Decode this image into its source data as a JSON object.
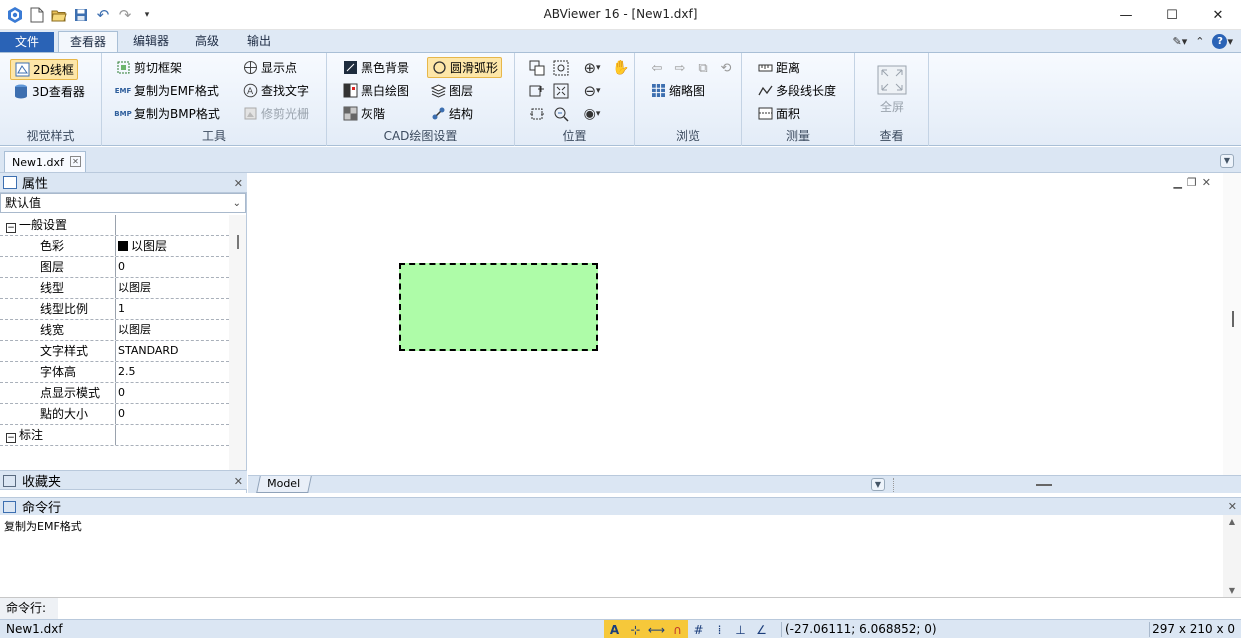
{
  "window": {
    "title": "ABViewer 16 - [New1.dxf]",
    "minimize_glyph": "—",
    "maximize_glyph": "☐",
    "close_glyph": "✕"
  },
  "ribbon_tabs": {
    "file": "文件",
    "viewer": "查看器",
    "editor": "编辑器",
    "advanced": "高级",
    "output": "输出"
  },
  "groups": {
    "visual_style": {
      "label": "视觉样式",
      "btn_2d": "2D线框",
      "btn_3d": "3D查看器"
    },
    "tools": {
      "label": "工具",
      "clip_frame": "剪切框架",
      "copy_emf": "复制为EMF格式",
      "copy_bmp": "复制为BMP格式",
      "show_points": "显示点",
      "find_text": "查找文字",
      "trim_raster": "修剪光栅"
    },
    "cad_settings": {
      "label": "CAD绘图设置",
      "black_bg": "黑色背景",
      "bw_drawing": "黑白绘图",
      "grayscale": "灰階",
      "smooth_arcs": "圆滑弧形",
      "layers": "图层",
      "structure": "结构"
    },
    "position": {
      "label": "位置"
    },
    "browse": {
      "label": "浏览",
      "thumbnail": "缩略图"
    },
    "measure": {
      "label": "测量",
      "distance": "距离",
      "polyline_length": "多段线长度",
      "area": "面积"
    },
    "view": {
      "label": "查看",
      "fullscreen": "全屏"
    }
  },
  "document": {
    "tab_name": "New1.dxf",
    "model_tab": "Model"
  },
  "properties": {
    "title": "属性",
    "select_value": "默认值",
    "categories": {
      "general": "一般设置",
      "annotation": "标注"
    },
    "rows": [
      {
        "key": "色彩",
        "value": "以图层"
      },
      {
        "key": "图层",
        "value": "0"
      },
      {
        "key": "线型",
        "value": "以图层"
      },
      {
        "key": "线型比例",
        "value": "1"
      },
      {
        "key": "线宽",
        "value": "以图层"
      },
      {
        "key": "文字样式",
        "value": "STANDARD"
      },
      {
        "key": "字体高",
        "value": "2.5"
      },
      {
        "key": "点显示模式",
        "value": "0"
      },
      {
        "key": "點的大小",
        "value": "0"
      }
    ]
  },
  "favorites": {
    "title": "收藏夹"
  },
  "command": {
    "title": "命令行",
    "output": "复制为EMF格式",
    "prompt": "命令行:",
    "input_value": ""
  },
  "status": {
    "filename": "New1.dxf",
    "coordinates": "(-27.06111; 6.068852; 0)",
    "drawing_size": "297 x 210 x 0"
  },
  "colors": {
    "accent": "#2a63b6",
    "rect_fill": "#aefca8",
    "ribbon_bg": "#e3ecf7",
    "selected": "#fde6a8"
  }
}
